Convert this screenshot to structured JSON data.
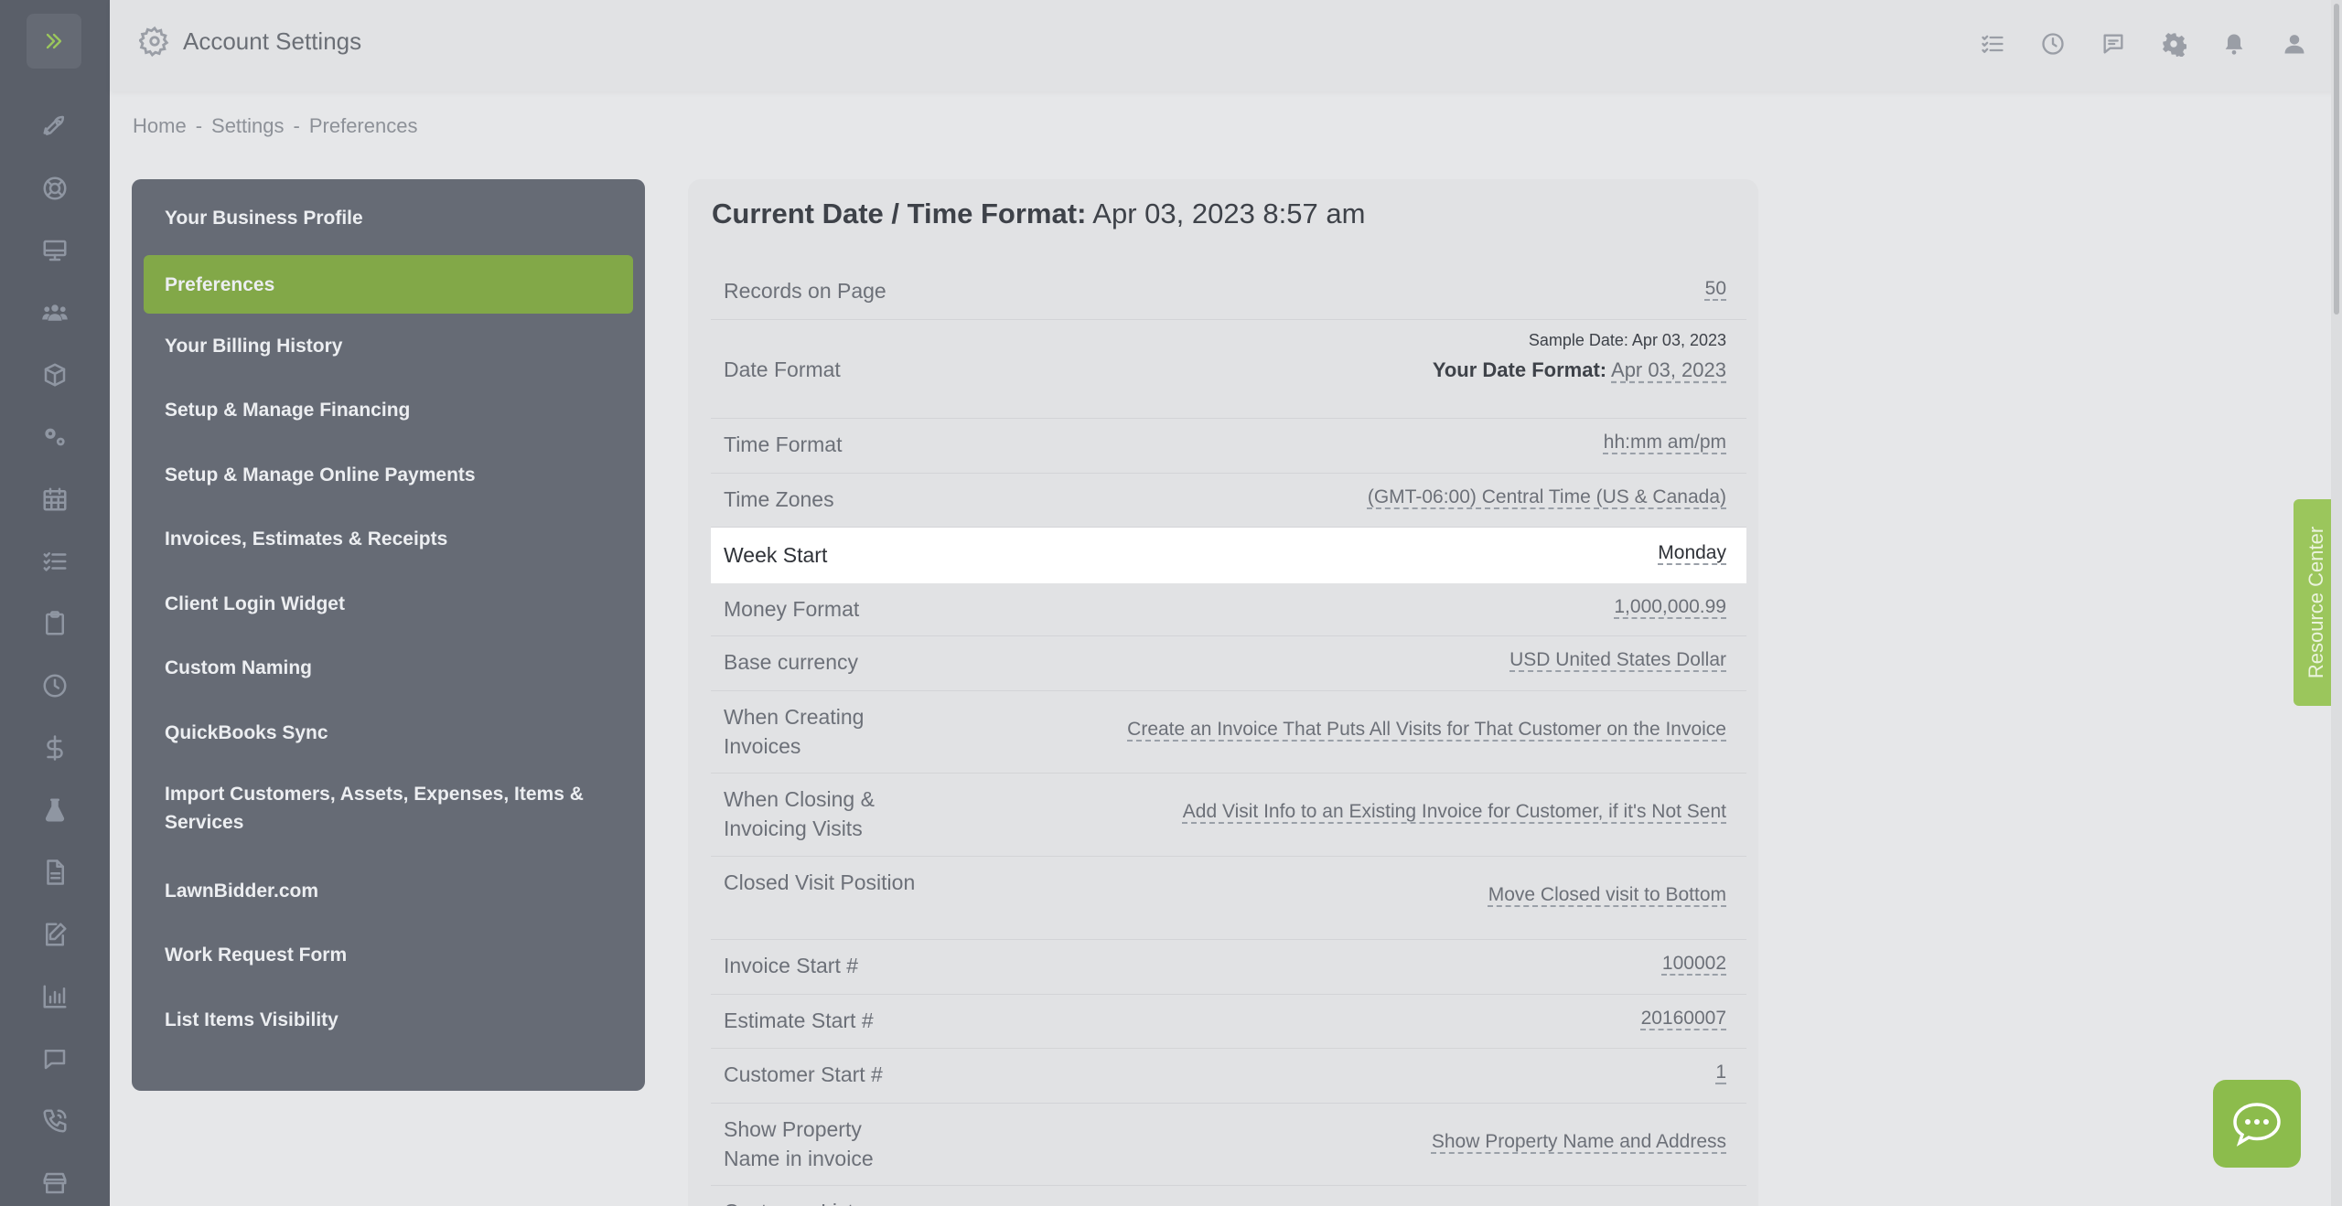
{
  "header": {
    "title": "Account Settings",
    "icons": [
      "checklist-icon",
      "clock-icon",
      "message-icon",
      "gear-icon",
      "bell-icon",
      "user-icon"
    ]
  },
  "rail": {
    "icons": [
      "chevrons-right-icon",
      "rocket-icon",
      "lifebuoy-icon",
      "monitor-icon",
      "users-icon",
      "box-icon",
      "gears-icon",
      "calendar-icon",
      "task-list-icon",
      "clipboard-icon",
      "clock-icon",
      "dollar-icon",
      "flask-icon",
      "document-icon",
      "edit-document-icon",
      "bar-chart-icon",
      "chat-icon",
      "phone-icon",
      "store-icon"
    ]
  },
  "breadcrumb": {
    "home": "Home",
    "settings": "Settings",
    "current": "Preferences",
    "separator": "-"
  },
  "menu": {
    "items": [
      {
        "label": "Your Business Profile"
      },
      {
        "label": "Preferences",
        "active": true
      },
      {
        "label": "Your Billing History"
      },
      {
        "label": "Setup & Manage Financing"
      },
      {
        "label": "Setup & Manage Online Payments"
      },
      {
        "label": "Invoices, Estimates & Receipts"
      },
      {
        "label": "Client Login Widget"
      },
      {
        "label": "Custom Naming"
      },
      {
        "label": "QuickBooks Sync"
      },
      {
        "label": "Import Customers, Assets, Expenses, Items & Services"
      },
      {
        "label": "LawnBidder.com"
      },
      {
        "label": "Work Request Form"
      },
      {
        "label": "List Items Visibility"
      }
    ]
  },
  "main": {
    "heading_label": "Current Date / Time Format:",
    "heading_value": "Apr 03, 2023 8:57 am",
    "date_format": {
      "sample_text": "Sample Date: Apr 03, 2023",
      "your_label": "Your Date Format:",
      "your_value": "Apr 03, 2023"
    },
    "rows": [
      {
        "label": "Records on Page",
        "value": "50"
      },
      {
        "label": "Date Format",
        "value": ""
      },
      {
        "label": "Time Format",
        "value": "hh:mm am/pm"
      },
      {
        "label": "Time Zones",
        "value": "(GMT-06:00) Central Time (US & Canada)"
      },
      {
        "label": "Week Start",
        "value": "Monday",
        "highlighted": true
      },
      {
        "label": "Money Format",
        "value": "1,000,000.99"
      },
      {
        "label": "Base currency",
        "value": "USD United States Dollar"
      },
      {
        "label": "When Creating Invoices",
        "value": "Create an Invoice That Puts All Visits for That Customer on the Invoice"
      },
      {
        "label": "When Closing & Invoicing Visits",
        "value": "Add Visit Info to an Existing Invoice for Customer, if it's Not Sent"
      },
      {
        "label": "Closed Visit Position",
        "value": "Move Closed visit to Bottom"
      },
      {
        "label": "Invoice Start #",
        "value": "100002"
      },
      {
        "label": "Estimate Start #",
        "value": "20160007"
      },
      {
        "label": "Customer Start #",
        "value": "1"
      },
      {
        "label": "Show Property Name in invoice",
        "value": "Show Property Name and Address"
      },
      {
        "label": "Customer List",
        "value": ""
      }
    ]
  },
  "resource_center": {
    "label": "Resource Center"
  },
  "chat_button": {
    "icon": "chat-bubble-icon"
  },
  "colors": {
    "accent_green": "#82a848",
    "sidebar_bg": "#666b75",
    "rail_bg": "#5a5f69"
  }
}
